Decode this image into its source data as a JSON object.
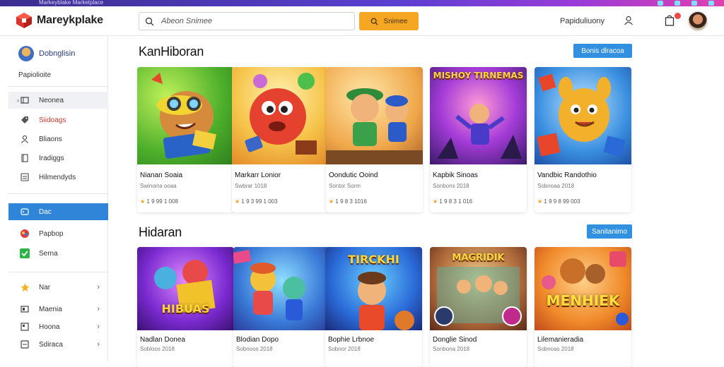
{
  "topbar": {
    "title": "Markeyblake Marketplace"
  },
  "header": {
    "logo_text": "Mareykplake",
    "search_placeholder": "Abeon Snimee",
    "search_button": "Snimee",
    "link": "Papiduliuony"
  },
  "sidebar": {
    "profile_name": "Dobnglisin",
    "subtitle": "Papiolioite",
    "items": [
      {
        "label": "Neonea",
        "icon": "film-icon"
      },
      {
        "label": "Siidoags",
        "icon": "tag-icon"
      },
      {
        "label": "Bliaons",
        "icon": "user-icon"
      },
      {
        "label": "Iradiggs",
        "icon": "book-icon"
      },
      {
        "label": "Hilmendyds",
        "icon": "list-icon"
      }
    ],
    "group2": [
      {
        "label": "Dac",
        "icon": "gamepad-icon"
      },
      {
        "label": "Papbop",
        "icon": "puzzle-icon"
      },
      {
        "label": "Serna",
        "icon": "check-icon"
      }
    ],
    "group3": [
      {
        "label": "Nar",
        "icon": "star-icon"
      },
      {
        "label": "Maenia",
        "icon": "monitor-icon"
      },
      {
        "label": "Hoona",
        "icon": "grid-icon"
      },
      {
        "label": "Sdiraca",
        "icon": "display-icon"
      }
    ]
  },
  "sections": [
    {
      "title": "KanHiboran",
      "button": "Bonis dlracoa",
      "cards": [
        {
          "title": "Nianan Soaia",
          "meta": "Swinorra ooaa",
          "rating": "1 9 99 1 008"
        },
        {
          "title": "Markarr Lonior",
          "meta": "Swbrar 1018",
          "rating": "1 9 3 99 1 003"
        },
        {
          "title": "Oondutic Ooind",
          "meta": "Sontor Sorm",
          "rating": "1 9 8 3 1016"
        },
        {
          "title": "Kapbik Sinoas",
          "meta": "Sonbons 2018",
          "rating": "1 9 8 3 1 016"
        },
        {
          "title": "Vandbic Randothio",
          "meta": "Sobnoaa 2018",
          "rating": "1 9 9 8 99 003"
        }
      ]
    },
    {
      "title": "Hidaran",
      "button": "Sanitanimo",
      "cards": [
        {
          "title": "Nadlan Donea",
          "meta": "Sobloos 2018",
          "overlay": "HIBUAS"
        },
        {
          "title": "Blodian Dopo",
          "meta": "Sobnoos 2018",
          "overlay": ""
        },
        {
          "title": "Bophie Lrbnoe",
          "meta": "Sobnor 2018",
          "overlay": "TIRCKHI"
        },
        {
          "title": "Donglie Sinod",
          "meta": "Sonbona 2018",
          "overlay": "MAGRIDIK"
        },
        {
          "title": "Lilemanieradia",
          "meta": "Sobnoas 2018",
          "overlay": "MENHIEK"
        }
      ]
    }
  ],
  "card_overlays_row1": [
    "",
    "",
    "",
    "MISHOY TIRNEMAS",
    ""
  ],
  "colors": {
    "accent": "#3191e0",
    "search_button": "#f5a623",
    "sidebar_active": "#2f86d9"
  }
}
